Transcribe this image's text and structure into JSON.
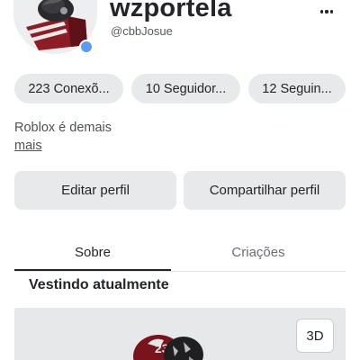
{
  "profile": {
    "display_name": "wzportela",
    "handle": "@cbbJosue",
    "status_color": "#5b9bf5"
  },
  "stats": [
    {
      "label": "223 Conexõ..."
    },
    {
      "label": "10 Seguidor..."
    },
    {
      "label": "12 Seguin..."
    }
  ],
  "bio": {
    "text": "Roblox é demais",
    "more_label": "mais"
  },
  "actions": {
    "edit_label": "Editar perfil",
    "share_label": "Compartilhar perfil"
  },
  "tabs": [
    {
      "label": "Sobre",
      "active": true
    },
    {
      "label": "Criações",
      "active": false
    }
  ],
  "section": {
    "title": "Vestindo atualmente"
  },
  "viewer": {
    "toggle_label": "3D"
  },
  "icons": {
    "more": "more-horizontal-icon"
  }
}
